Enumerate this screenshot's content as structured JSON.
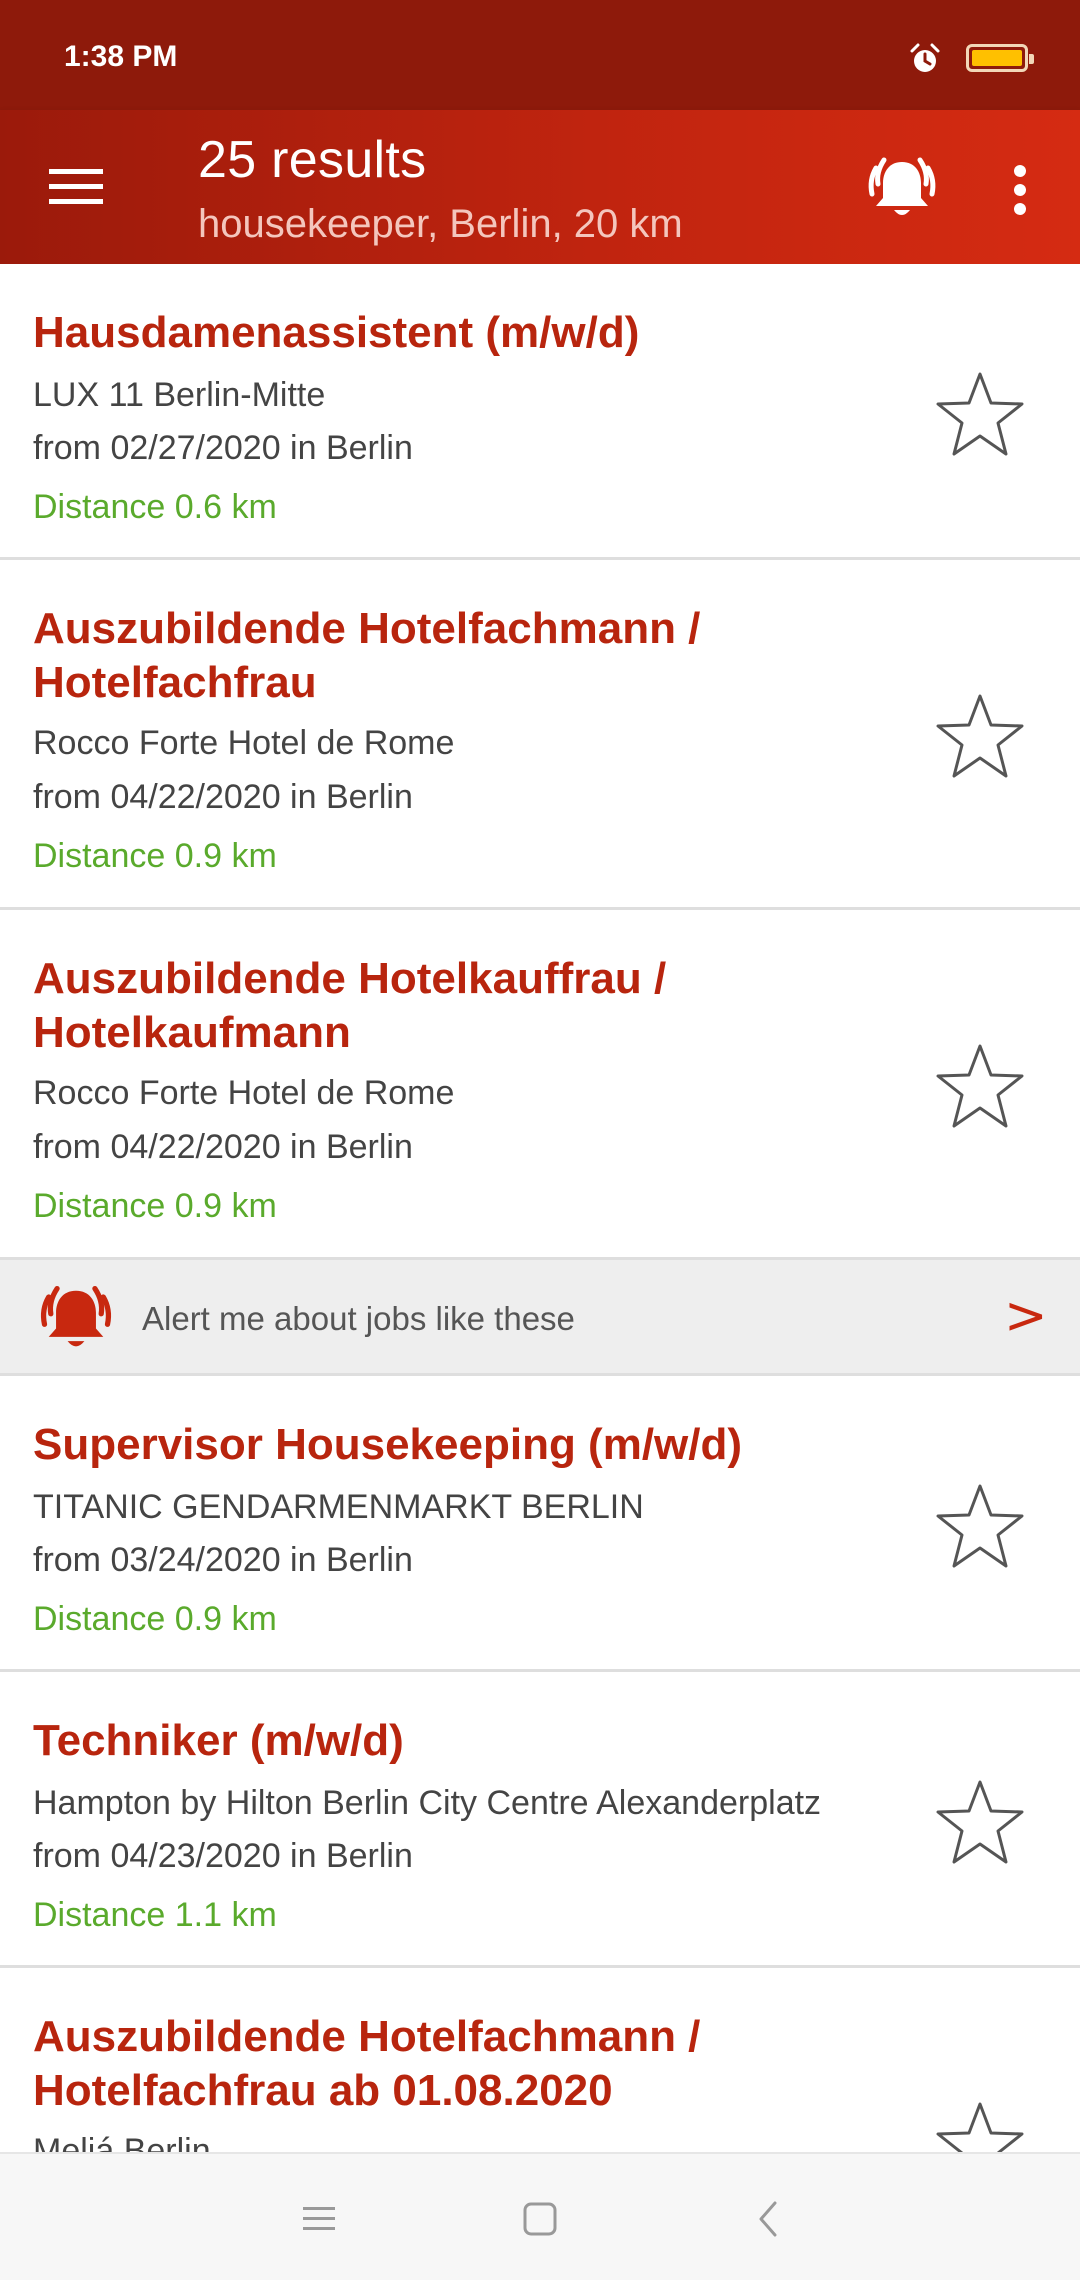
{
  "status_bar": {
    "time": "1:38 PM"
  },
  "toolbar": {
    "title": "25 results",
    "subtitle": "housekeeper, Berlin, 20 km"
  },
  "colors": {
    "accent": "#b8250e",
    "distance": "#5aaa2c",
    "toolbar": "#c0240f"
  },
  "jobs": [
    {
      "title": "Hausdamenassistent (m/w/d)",
      "company": "LUX 11 Berlin-Mitte",
      "date": "from 02/27/2020 in Berlin",
      "distance": "Distance 0.6 km"
    },
    {
      "title": "Auszubildende Hotelfachmann / Hotelfachfrau",
      "company": "Rocco Forte Hotel de Rome",
      "date": "from 04/22/2020 in Berlin",
      "distance": "Distance 0.9 km"
    },
    {
      "title": "Auszubildende Hotelkauffrau / Hotelkaufmann",
      "company": "Rocco Forte Hotel de Rome",
      "date": "from 04/22/2020 in Berlin",
      "distance": "Distance 0.9 km"
    },
    {
      "title": "Supervisor Housekeeping (m/w/d)",
      "company": "TITANIC GENDARMENMARKT BERLIN",
      "date": "from 03/24/2020 in Berlin",
      "distance": "Distance 0.9 km"
    },
    {
      "title": "Techniker (m/w/d)",
      "company": "Hampton by Hilton Berlin City Centre Alexanderplatz",
      "date": "from 04/23/2020 in Berlin",
      "distance": "Distance 1.1 km"
    },
    {
      "title": "Auszubildende Hotelfachmann / Hotelfachfrau ab 01.08.2020",
      "company": "Meliá Berlin"
    }
  ],
  "alert_banner": {
    "text": "Alert me about jobs like these",
    "arrow": ">"
  },
  "icons": {
    "menu": "menu-icon",
    "alert": "alert-bell-icon",
    "more": "more-vert-icon",
    "star": "star-outline-icon"
  }
}
